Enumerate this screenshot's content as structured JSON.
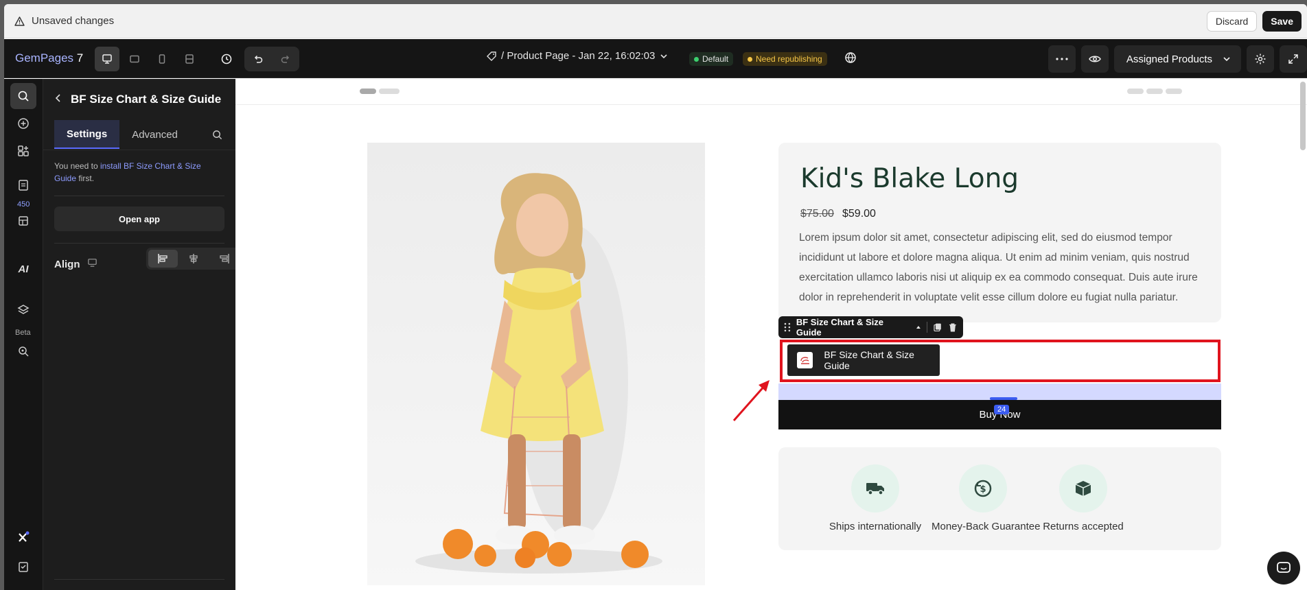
{
  "unsaved_bar": {
    "message": "Unsaved changes",
    "discard_label": "Discard",
    "save_label": "Save"
  },
  "topbar": {
    "logo": "GemPages",
    "logo_version": "7",
    "page_title": "/ Product Page - Jan 22, 16:02:03",
    "badge_default": "Default",
    "badge_republish": "Need republishing",
    "assigned_label": "Assigned Products",
    "colors": {
      "accent": "#5b6bff",
      "default_dot": "#3ccf6e",
      "republish_dot": "#f6c646"
    }
  },
  "rail": {
    "badge_count": "450",
    "ai_label": "AI",
    "beta_label": "Beta"
  },
  "panel": {
    "title": "BF Size Chart & Size Guide",
    "tabs": [
      "Settings",
      "Advanced"
    ],
    "note_prefix": "You need to ",
    "note_link": "install BF Size Chart & Size Guide",
    "note_suffix": " first.",
    "open_app_label": "Open app",
    "align_label": "Align"
  },
  "product": {
    "title": "Kid's Blake Long",
    "price_old": "$75.00",
    "price_new": "$59.00",
    "description": "Lorem ipsum dolor sit amet, consectetur adipiscing elit, sed do eiusmod tempor incididunt ut labore et dolore magna aliqua. Ut enim ad minim veniam, quis nostrud exercitation ullamco laboris nisi ut aliquip ex ea commodo consequat. Duis aute irure dolor in reprehenderit in voluptate velit esse cillum dolore eu fugiat nulla pariatur.",
    "selected_element": "BF Size Chart & Size Guide",
    "app_button_label": "BF Size Chart & Size Guide",
    "gap_value": "24",
    "buy_now_label": "Buy Now",
    "features": [
      {
        "icon": "truck-icon",
        "label": "Ships internationally"
      },
      {
        "icon": "money-back-icon",
        "label": "Money-Back Guarantee"
      },
      {
        "icon": "box-icon",
        "label": "Returns accepted"
      }
    ]
  }
}
